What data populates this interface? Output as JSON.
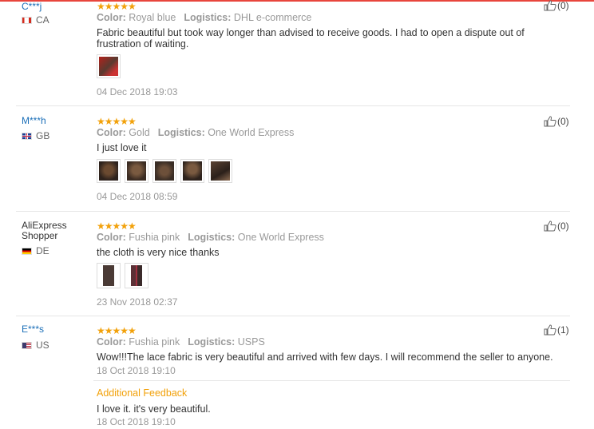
{
  "reviews": [
    {
      "user": "C***j",
      "country": "CA",
      "color_label": "Color:",
      "color": "Royal blue",
      "logistics_label": "Logistics:",
      "logistics": "DHL e-commerce",
      "text": "Fabric beautiful but took way longer than advised to receive goods. I had to open a dispute out of frustration of waiting.",
      "date": "04 Dec 2018 19:03",
      "likes": "(0)"
    },
    {
      "user": "M***h",
      "country": "GB",
      "color_label": "Color:",
      "color": "Gold",
      "logistics_label": "Logistics:",
      "logistics": "One World Express",
      "text": "I just love it",
      "date": "04 Dec 2018 08:59",
      "likes": "(0)"
    },
    {
      "user": "AliExpress Shopper",
      "country": "DE",
      "color_label": "Color:",
      "color": "Fushia pink",
      "logistics_label": "Logistics:",
      "logistics": "One World Express",
      "text": "the cloth is very nice thanks",
      "date": "23 Nov 2018 02:37",
      "likes": "(0)"
    },
    {
      "user": "E***s",
      "country": "US",
      "color_label": "Color:",
      "color": "Fushia pink",
      "logistics_label": "Logistics:",
      "logistics": "USPS",
      "text": "Wow!!!The lace fabric is very beautiful and arrived with few days. I will recommend the seller to anyone.",
      "date": "18 Oct 2018 19:10",
      "likes": "(1)",
      "additional_feedback_label": "Additional Feedback",
      "additional_text": "I love it. it's very beautiful.",
      "additional_date": "18 Oct 2018 19:10"
    }
  ],
  "colors": {
    "link": "#1b6fb8",
    "star": "#f2a10a",
    "accent": "#e8453c"
  }
}
